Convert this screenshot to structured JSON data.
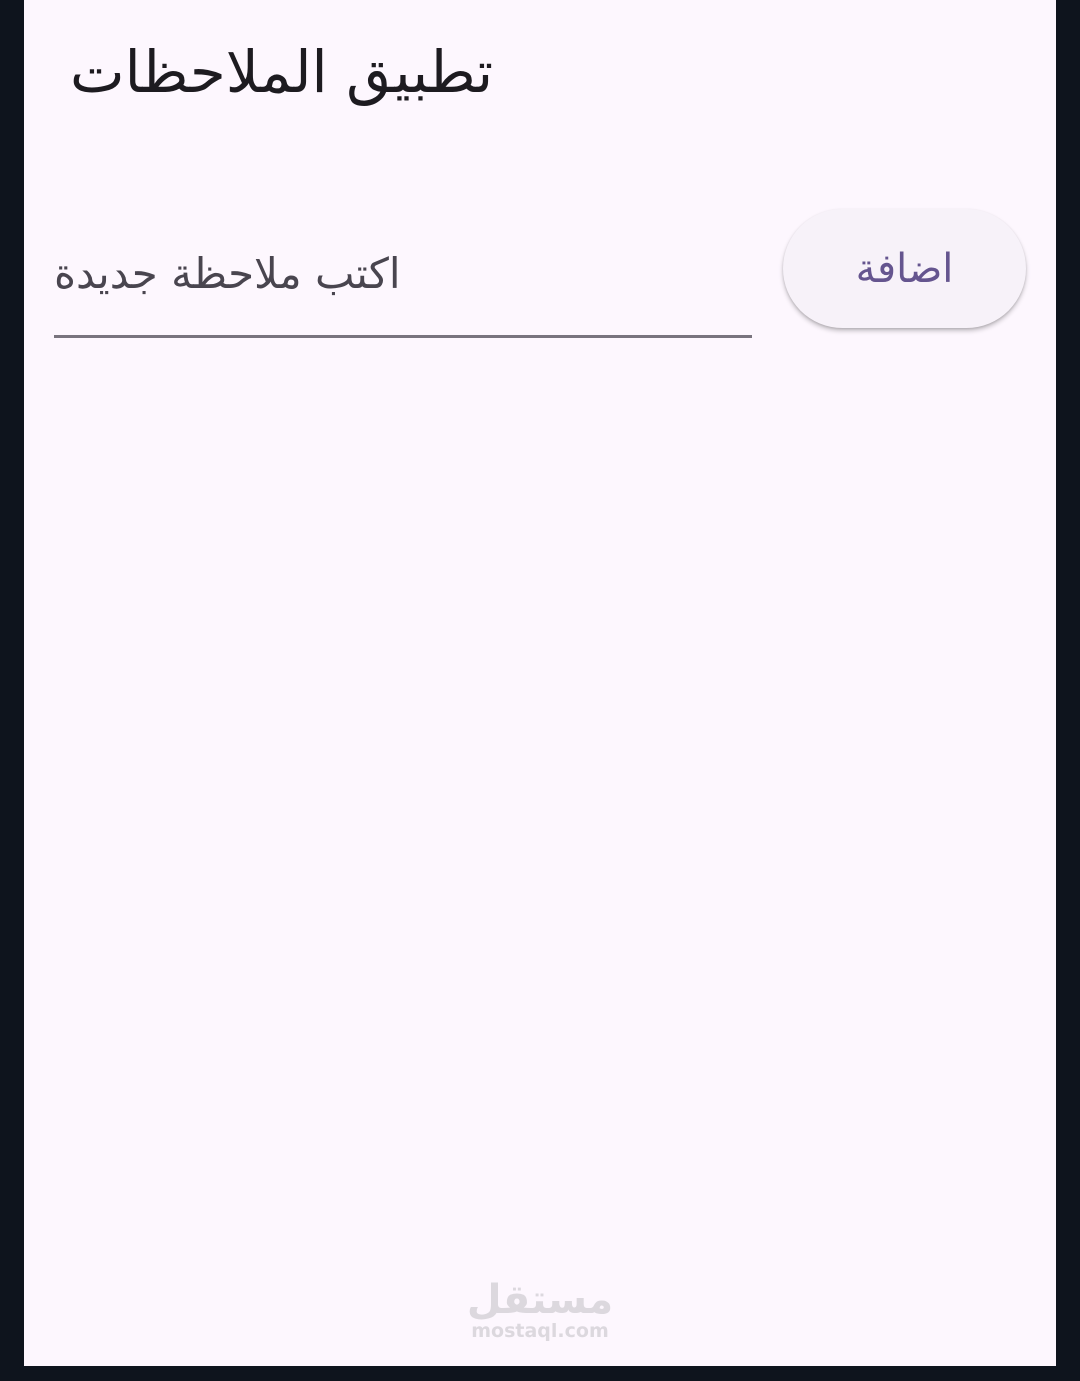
{
  "app": {
    "title": "تطبيق الملاحظات"
  },
  "note_form": {
    "input_placeholder": "اكتب ملاحظة جديدة",
    "input_value": "",
    "add_button_label": "اضافة"
  },
  "watermark": {
    "arabic": "مستقل",
    "latin": "mostaql.com"
  },
  "colors": {
    "background": "#fdf7fe",
    "frame": "#0e141d",
    "title_text": "#1d1b20",
    "placeholder_text": "#49454f",
    "underline": "#79747e",
    "button_background": "#f7f2f9",
    "button_text": "#65558f"
  }
}
